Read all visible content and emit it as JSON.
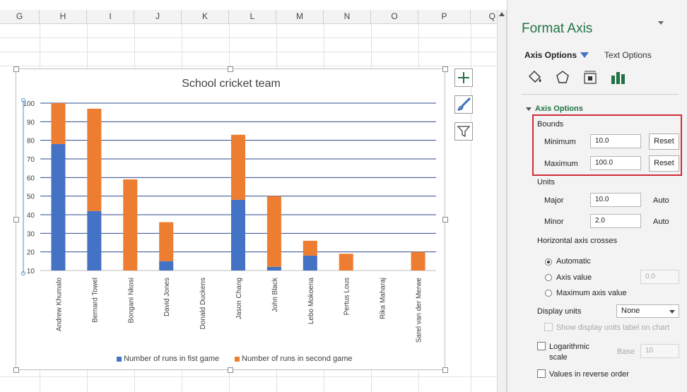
{
  "spreadsheet": {
    "columns": [
      "G",
      "H",
      "I",
      "J",
      "K",
      "L",
      "M",
      "N",
      "O",
      "P",
      "Q"
    ]
  },
  "chart_data": {
    "type": "bar",
    "stacked": true,
    "title": "School cricket team",
    "categories": [
      "Andrew Khumalo",
      "Bernard Towel",
      "Bongani Nkosi",
      "David Jones",
      "Donald Duckens",
      "Jason Chang",
      "John Black",
      "Lebo Mokoena",
      "Pertus Lous",
      "Rika Maharaj",
      "Sarel van der Merwe"
    ],
    "series": [
      {
        "name": "Number of runs in fist game",
        "color": "#4472c4",
        "values": [
          78,
          42,
          0,
          15,
          0,
          48,
          12,
          18,
          0,
          0,
          0
        ]
      },
      {
        "name": "Number of runs in second game",
        "color": "#ed7d31",
        "values": [
          22,
          55,
          59,
          21,
          0,
          35,
          38,
          8,
          19,
          0,
          20
        ]
      }
    ],
    "ylim": [
      10,
      100
    ],
    "yticks": [
      10,
      20,
      30,
      40,
      50,
      60,
      70,
      80,
      90,
      100
    ],
    "grid": true,
    "legend_position": "bottom"
  },
  "chart_tools": {
    "add_element_icon": "plus-icon",
    "style_icon": "brush-icon",
    "filter_icon": "filter-icon"
  },
  "pane": {
    "title": "Format Axis",
    "tabs": {
      "axis_options": "Axis Options",
      "text_options": "Text Options"
    },
    "icons": [
      "fill-line-icon",
      "effects-icon",
      "size-properties-icon",
      "axis-options-icon"
    ],
    "section": "Axis Options",
    "bounds": {
      "label": "Bounds",
      "minimum_label": "Minimum",
      "minimum_value": "10.0",
      "maximum_label": "Maximum",
      "maximum_value": "100.0",
      "reset_label": "Reset"
    },
    "units": {
      "label": "Units",
      "major_label": "Major",
      "major_value": "10.0",
      "minor_label": "Minor",
      "minor_value": "2.0",
      "auto_label": "Auto"
    },
    "horizontal_axis_crosses": {
      "label": "Horizontal axis crosses",
      "automatic": "Automatic",
      "axis_value": "Axis value",
      "axis_value_input": "0.0",
      "maximum_axis_value": "Maximum axis value",
      "selected": "Automatic"
    },
    "display_units": {
      "label": "Display units",
      "value": "None",
      "show_label": "Show display units label on chart"
    },
    "logarithmic": {
      "label": "Logarithmic scale",
      "base_label": "Base",
      "base_value": "10",
      "checked": false
    },
    "reverse_order": {
      "label": "Values in reverse order",
      "checked": false
    },
    "accent_color": "#217346",
    "highlight_color": "#d22b3a"
  }
}
